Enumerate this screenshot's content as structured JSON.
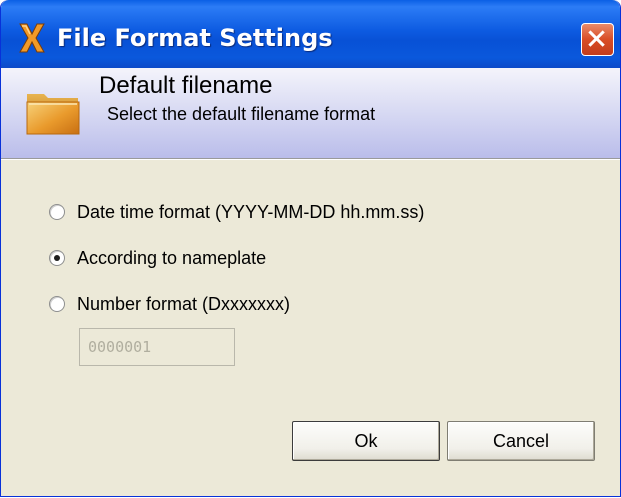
{
  "window": {
    "title": "File Format Settings",
    "app_icon": "x-logo-icon",
    "close_icon": "close-icon"
  },
  "header": {
    "icon": "folder-icon",
    "title": "Default filename",
    "subtitle": "Select the default filename format"
  },
  "options": [
    {
      "label": "Date time format (YYYY-MM-DD hh.mm.ss)",
      "checked": false
    },
    {
      "label": "According to nameplate",
      "checked": true
    },
    {
      "label": "Number format (Dxxxxxxx)",
      "checked": false
    }
  ],
  "number_field": {
    "value": "0000001",
    "enabled": false
  },
  "buttons": {
    "ok": "Ok",
    "cancel": "Cancel"
  },
  "colors": {
    "titlebar": "#0a58dc",
    "close_button": "#d94d26",
    "dialog_background": "#ece9d8",
    "header_band": "#d4d6f2"
  }
}
